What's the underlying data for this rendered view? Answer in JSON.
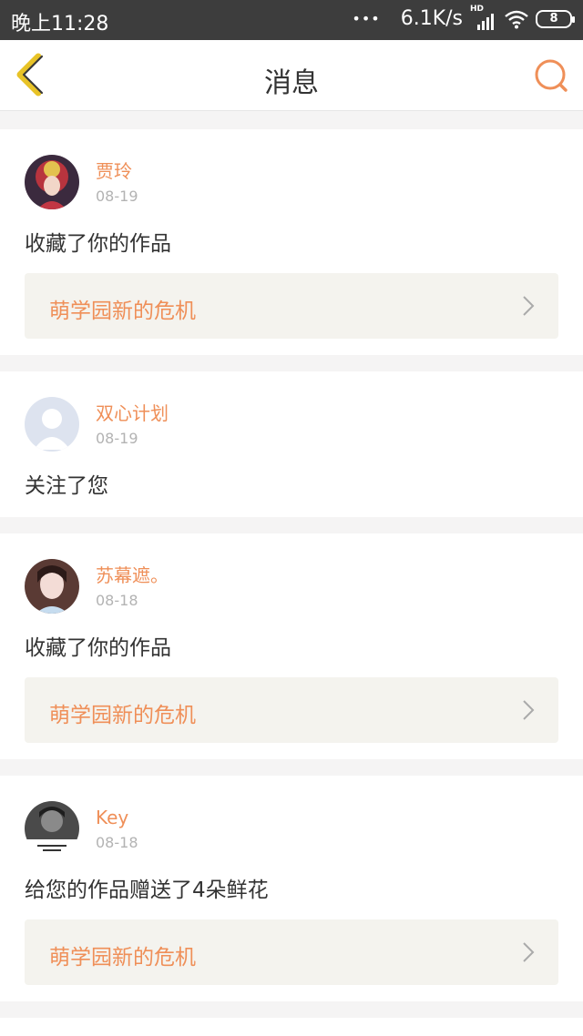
{
  "status_bar": {
    "time": "晚上11:28",
    "dots": "•••",
    "network_speed": "6.1K/s",
    "hd_label": "HD",
    "battery_level": "8"
  },
  "nav": {
    "title": "消息",
    "back_icon": "chevron-left-icon",
    "search_icon": "search-icon",
    "accent_color": "#ef8f58"
  },
  "messages": [
    {
      "username": "贾玲",
      "date": "08-19",
      "action": "收藏了你的作品",
      "work_title": "萌学园新的危机"
    },
    {
      "username": "双心计划",
      "date": "08-19",
      "action": "关注了您"
    },
    {
      "username": "苏幕遮。",
      "date": "08-18",
      "action": "收藏了你的作品",
      "work_title": "萌学园新的危机"
    },
    {
      "username": "Key",
      "date": "08-18",
      "action": "给您的作品赠送了4朵鲜花",
      "work_title": "萌学园新的危机"
    }
  ]
}
